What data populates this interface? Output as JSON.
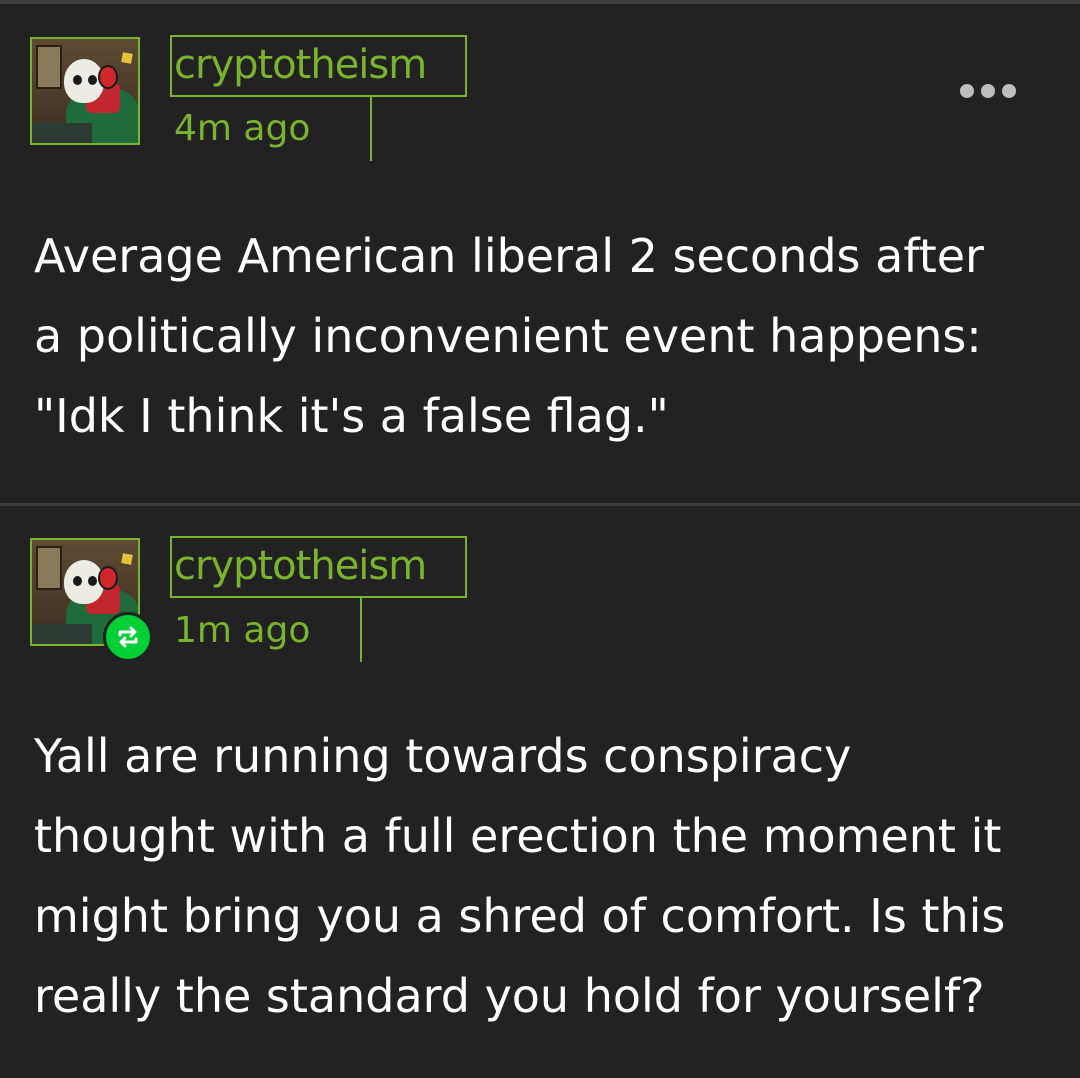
{
  "post1": {
    "username": "cryptotheism",
    "timestamp": "4m ago",
    "text_lines": [
      "Average American liberal 2 seconds after",
      "a politically inconvenient event happens:",
      "\"Idk I think it's a false flag.\""
    ]
  },
  "post2": {
    "username": "cryptotheism",
    "timestamp": "1m ago",
    "text_lines": [
      "Yall are running towards conspiracy",
      "thought with a full erection the moment it",
      "might bring you a shred of comfort. Is this",
      "really the standard you hold for yourself?"
    ]
  },
  "icons": {
    "more": "more-options-icon",
    "reblog": "reblog-icon"
  },
  "colors": {
    "accent": "#7ab32e",
    "background": "#222222",
    "reblog": "#00cf35",
    "text": "#ffffff"
  }
}
